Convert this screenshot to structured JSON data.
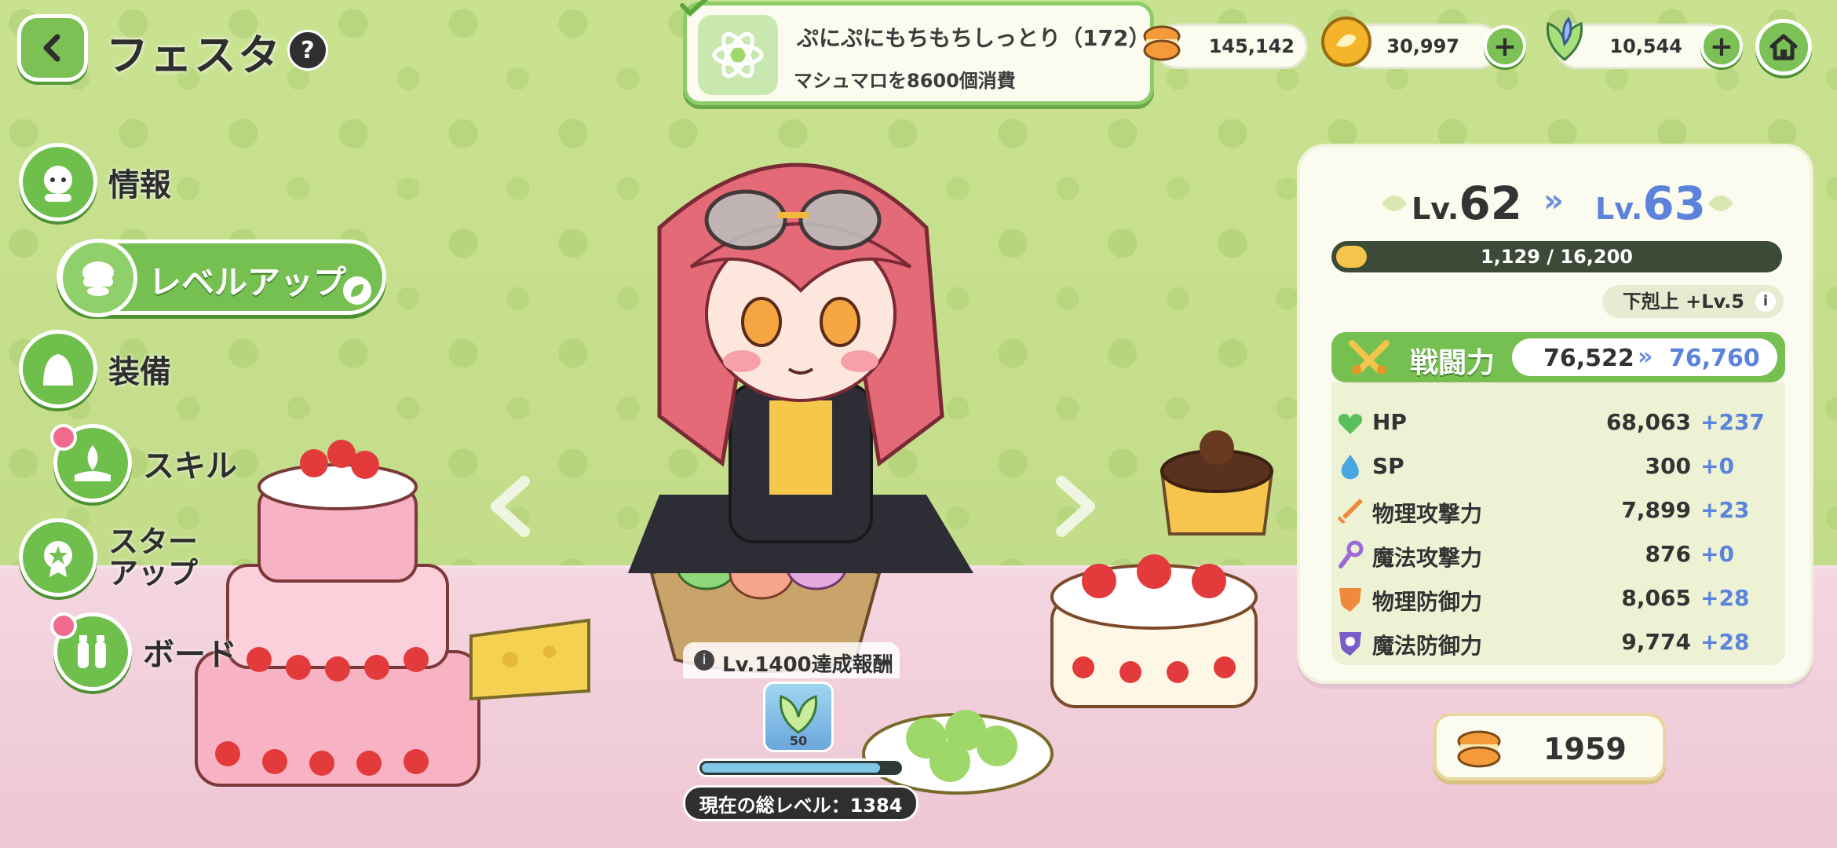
{
  "header": {
    "title": "フェスタ",
    "help_symbol": "?"
  },
  "menu": {
    "items": [
      {
        "label": "情報"
      },
      {
        "label": "レベルアップ",
        "active": true
      },
      {
        "label": "装備"
      },
      {
        "label": "スキル"
      },
      {
        "label": "スター\nアップ",
        "line1": "スター",
        "line2": "アップ"
      },
      {
        "label": "ボード"
      }
    ]
  },
  "quest": {
    "title": "ぷにぷにもちもちしっとり（172）",
    "subtitle": "マシュマロを8600個消費"
  },
  "currency": {
    "macaron": "145,142",
    "gold": "30,997",
    "crystal": "10,544"
  },
  "stats_panel": {
    "level_prefix": "Lv.",
    "level_current": "62",
    "level_next": "63",
    "arrow": "»",
    "exp_text": "1,129 / 16,200",
    "exp_fraction": 0.07,
    "bonus_text": "下剋上 +Lv.5",
    "power_label": "戦闘力",
    "power_current": "76,522",
    "power_next": "76,760",
    "stats": [
      {
        "name": "HP",
        "value": "68,063",
        "add": "+237",
        "icon": "heart-icon",
        "color": "#5bbf5b"
      },
      {
        "name": "SP",
        "value": "300",
        "add": "+0",
        "icon": "sp-drop-icon",
        "color": "#4aa6e0"
      },
      {
        "name": "物理攻撃力",
        "value": "7,899",
        "add": "+23",
        "icon": "sword-icon",
        "color": "#ef8a3c"
      },
      {
        "name": "魔法攻撃力",
        "value": "876",
        "add": "+0",
        "icon": "wand-icon",
        "color": "#9b6ad8"
      },
      {
        "name": "物理防御力",
        "value": "8,065",
        "add": "+28",
        "icon": "shield-icon",
        "color": "#ef8a3c"
      },
      {
        "name": "魔法防御力",
        "value": "9,774",
        "add": "+28",
        "icon": "magic-shield-icon",
        "color": "#7a5cc8"
      }
    ]
  },
  "item_count": "1959",
  "reward": {
    "label": "Lv.1400達成報酬",
    "card_count": "50",
    "progress_fraction": 0.9,
    "total_level": "現在の総レベル：1384"
  },
  "colors": {
    "accent_green": "#76c052",
    "next_blue": "#5b83dc",
    "background": "#c6df8e"
  }
}
